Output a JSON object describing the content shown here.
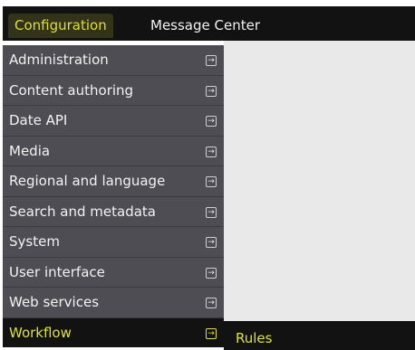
{
  "topbar": {
    "tabs": [
      {
        "label": "Configuration"
      },
      {
        "label": "Message Center"
      }
    ]
  },
  "menu": {
    "arrow_glyph": "→",
    "items": [
      {
        "label": "Administration"
      },
      {
        "label": "Content authoring"
      },
      {
        "label": "Date API"
      },
      {
        "label": "Media"
      },
      {
        "label": "Regional and language"
      },
      {
        "label": "Search and metadata"
      },
      {
        "label": "System"
      },
      {
        "label": "User interface"
      },
      {
        "label": "Web services"
      },
      {
        "label": "Workflow"
      }
    ]
  },
  "submenu": {
    "items": [
      {
        "label": "Rules"
      }
    ]
  },
  "colors": {
    "bar_bg": "#121212",
    "menu_bg": "#4d4d53",
    "accent": "#e1e13a",
    "content_bg": "#e9e9e9"
  }
}
